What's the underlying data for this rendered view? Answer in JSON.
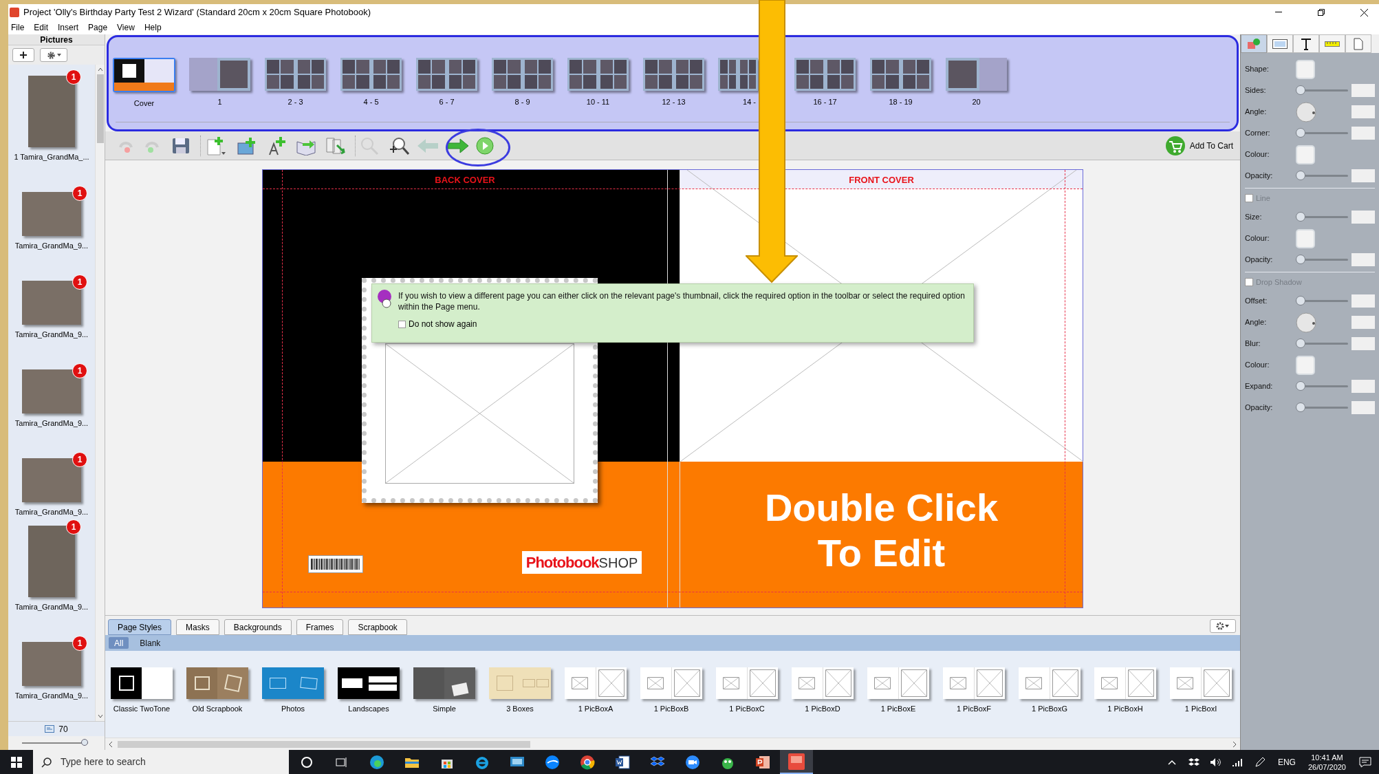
{
  "window": {
    "title": "Project 'Olly's Birthday Party Test 2 Wizard' (Standard 20cm x 20cm Square Photobook)"
  },
  "menu": [
    "File",
    "Edit",
    "Insert",
    "Page",
    "View",
    "Help"
  ],
  "pictures": {
    "title": "Pictures",
    "count": "70",
    "zoom_slider": {
      "level": 1
    },
    "items": [
      {
        "label": "1 Tamira_GrandMa_...",
        "badge": "1",
        "kind": "portrait"
      },
      {
        "label": "Tamira_GrandMa_9...",
        "badge": "1",
        "kind": "landscape"
      },
      {
        "label": "Tamira_GrandMa_9...",
        "badge": "1",
        "kind": "landscape"
      },
      {
        "label": "Tamira_GrandMa_9...",
        "badge": "1",
        "kind": "landscape"
      },
      {
        "label": "Tamira_GrandMa_9...",
        "badge": "1",
        "kind": "landscape"
      },
      {
        "label": "Tamira_GrandMa_9...",
        "badge": "1",
        "kind": "portrait"
      },
      {
        "label": "Tamira_GrandMa_9...",
        "badge": "1",
        "kind": "landscape"
      }
    ]
  },
  "pages": [
    {
      "label": "Cover",
      "selected": true,
      "kind": "cover"
    },
    {
      "label": "1",
      "selected": false,
      "kind": "right_only"
    },
    {
      "label": "2 - 3",
      "selected": false,
      "kind": "spread"
    },
    {
      "label": "4 - 5",
      "selected": false,
      "kind": "spread"
    },
    {
      "label": "6 - 7",
      "selected": false,
      "kind": "spread"
    },
    {
      "label": "8 - 9",
      "selected": false,
      "kind": "spread"
    },
    {
      "label": "10 - 11",
      "selected": false,
      "kind": "spread"
    },
    {
      "label": "12 - 13",
      "selected": false,
      "kind": "spread"
    },
    {
      "label": "14 -",
      "selected": false,
      "kind": "spread_partial"
    },
    {
      "label": "16 - 17",
      "selected": false,
      "kind": "spread"
    },
    {
      "label": "18 - 19",
      "selected": false,
      "kind": "spread"
    },
    {
      "label": "20",
      "selected": false,
      "kind": "left_only"
    }
  ],
  "toolbar": {
    "add_to_cart": "Add To Cart"
  },
  "spread": {
    "back_label": "BACK COVER",
    "front_label": "FRONT COVER",
    "title_lines": [
      "Double Click",
      "To Edit"
    ],
    "logo_bold": "Photobook",
    "logo_rest": "SHOP"
  },
  "tooltip": {
    "message": "If you wish to view a different page you can either click on the relevant page's thumbnail, click the required option in the toolbar or select the required option within the Page menu.",
    "checkbox": {
      "label": "Do not show again",
      "checked": false
    }
  },
  "properties": {
    "tabs": [
      {
        "kind": "shape",
        "selected": true
      },
      {
        "kind": "frame",
        "selected": false
      },
      {
        "kind": "text",
        "selected": false
      },
      {
        "kind": "ruler",
        "selected": false
      },
      {
        "kind": "page",
        "selected": false
      }
    ],
    "sections": [
      {
        "rows": [
          {
            "label": "Shape:",
            "kind": "swatch"
          },
          {
            "label": "Sides:",
            "kind": "slider",
            "level": 0
          },
          {
            "label": "Angle:",
            "kind": "dial"
          },
          {
            "label": "Corner:",
            "kind": "slider",
            "level": 0
          },
          {
            "label": "Colour:",
            "kind": "swatch"
          },
          {
            "label": "Opacity:",
            "kind": "slider",
            "level": 0
          }
        ]
      },
      {
        "header": {
          "label": "Line",
          "checked": false
        },
        "rows": [
          {
            "label": "Size:",
            "kind": "slider",
            "level": 0
          },
          {
            "label": "Colour:",
            "kind": "swatch"
          },
          {
            "label": "Opacity:",
            "kind": "slider",
            "level": 0
          }
        ]
      },
      {
        "header": {
          "label": "Drop Shadow",
          "checked": false
        },
        "rows": [
          {
            "label": "Offset:",
            "kind": "slider",
            "level": 0
          },
          {
            "label": "Angle:",
            "kind": "dial"
          },
          {
            "label": "Blur:",
            "kind": "slider",
            "level": 0
          },
          {
            "label": "Colour:",
            "kind": "swatch"
          },
          {
            "label": "Expand:",
            "kind": "slider",
            "level": 0
          },
          {
            "label": "Opacity:",
            "kind": "slider",
            "level": 0
          }
        ]
      }
    ]
  },
  "library": {
    "tabs": [
      {
        "label": "Page Styles",
        "selected": true
      },
      {
        "label": "Masks",
        "selected": false
      },
      {
        "label": "Backgrounds",
        "selected": false
      },
      {
        "label": "Frames",
        "selected": false
      },
      {
        "label": "Scrapbook",
        "selected": false
      }
    ],
    "filters": [
      {
        "label": "All",
        "selected": true
      },
      {
        "label": "Blank",
        "selected": false
      }
    ],
    "styles": [
      {
        "label": "Classic TwoTone",
        "kind": "twotone"
      },
      {
        "label": "Old Scrapbook",
        "kind": "scrapbook"
      },
      {
        "label": "Photos",
        "kind": "photos"
      },
      {
        "label": "Landscapes",
        "kind": "landscapes"
      },
      {
        "label": "Simple",
        "kind": "simple"
      },
      {
        "label": "3 Boxes",
        "kind": "boxes"
      },
      {
        "label": "1 PicBoxA",
        "kind": "picbox"
      },
      {
        "label": "1 PicBoxB",
        "kind": "picbox"
      },
      {
        "label": "1 PicBoxC",
        "kind": "picbox"
      },
      {
        "label": "1 PicBoxD",
        "kind": "picbox"
      },
      {
        "label": "1 PicBoxE",
        "kind": "picbox"
      },
      {
        "label": "1 PicBoxF",
        "kind": "picbox"
      },
      {
        "label": "1 PicBoxG",
        "kind": "picbox"
      },
      {
        "label": "1 PicBoxH",
        "kind": "picbox"
      },
      {
        "label": "1 PicBoxI",
        "kind": "picbox"
      }
    ]
  },
  "taskbar": {
    "search_placeholder": "Type here to search",
    "language": "ENG",
    "time": "10:41 AM",
    "date": "26/07/2020"
  }
}
